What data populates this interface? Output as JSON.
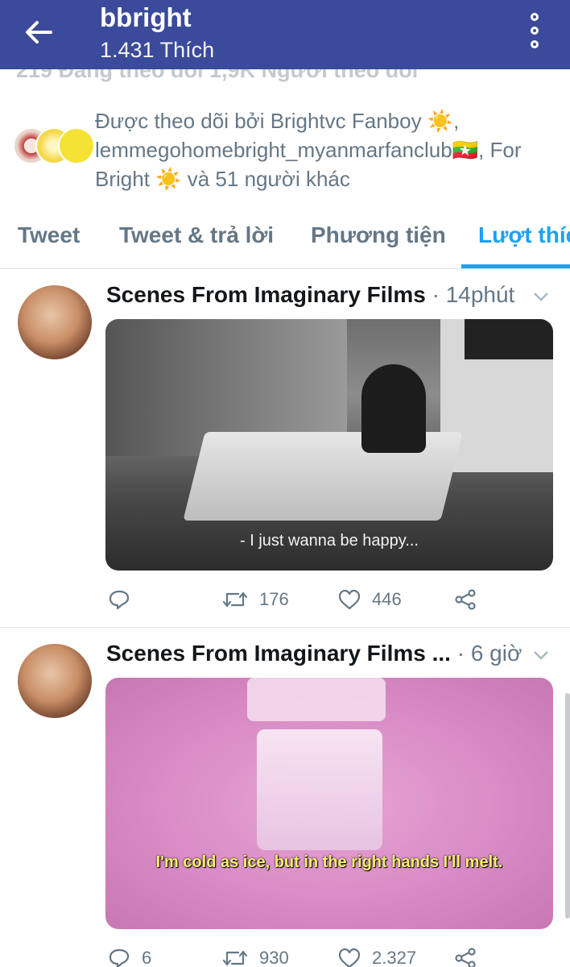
{
  "header": {
    "title": "bbright",
    "subtitle": "1.431 Thích",
    "peek_text": "219  Đang theo dõi     1,9K  Người theo dõi"
  },
  "followed": {
    "text": "Được theo dõi bởi Brightvc Fanboy ☀️, lemmegohomebright_myanmarfanclub🇲🇲, For Bright ☀️ và 51 người khác"
  },
  "tabs": [
    {
      "label": "Tweet"
    },
    {
      "label": "Tweet & trả lời"
    },
    {
      "label": "Phương tiện"
    },
    {
      "label": "Lượt thích",
      "active": true
    }
  ],
  "tweets": [
    {
      "name": "Scenes From Imaginary Films",
      "meta": "· 14phút",
      "caption": "- I just wanna be happy...",
      "reply_count": "",
      "retweet_count": "176",
      "like_count": "446"
    },
    {
      "name": "Scenes From Imaginary Films ...",
      "meta": "· 6 giờ",
      "caption": "I'm cold as ice, but in the right hands I'll melt.",
      "reply_count": "6",
      "retweet_count": "930",
      "like_count": "2.327"
    }
  ],
  "colors": {
    "appbar": "#3b4a9a",
    "accent": "#1da1f2",
    "muted": "#657786"
  }
}
